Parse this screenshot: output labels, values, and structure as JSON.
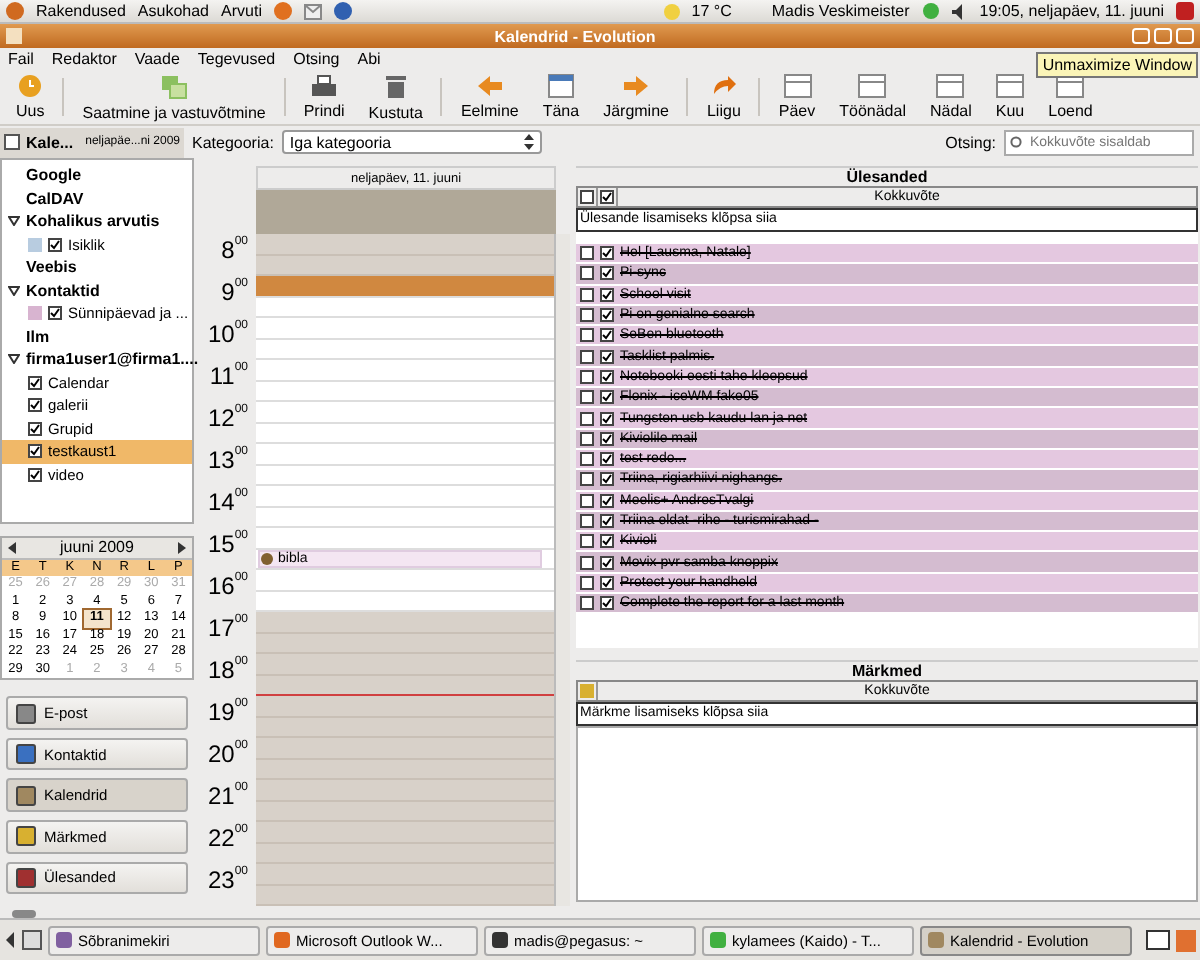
{
  "top_panel": {
    "menus": [
      "Rakendused",
      "Asukohad",
      "Arvuti"
    ],
    "weather": "17 °C",
    "user": "Madis Veskimeister",
    "clock": "19:05, neljapäev, 11. juuni"
  },
  "window": {
    "title": "Kalendrid - Evolution"
  },
  "menu": [
    "Fail",
    "Redaktor",
    "Vaade",
    "Tegevused",
    "Otsing",
    "Abi"
  ],
  "tooltip": "Unmaximize Window",
  "toolbar": [
    {
      "label": "Uus",
      "kind": "new"
    },
    {
      "label": "Saatmine ja vastuvõtmine",
      "kind": "sendrecv"
    },
    {
      "label": "Prindi",
      "kind": "print"
    },
    {
      "label": "Kustuta",
      "kind": "delete"
    },
    {
      "label": "Eelmine",
      "kind": "back"
    },
    {
      "label": "Täna",
      "kind": "today"
    },
    {
      "label": "Järgmine",
      "kind": "forward"
    },
    {
      "label": "Liigu",
      "kind": "goto"
    },
    {
      "label": "Päev",
      "kind": "view"
    },
    {
      "label": "Töönädal",
      "kind": "view"
    },
    {
      "label": "Nädal",
      "kind": "view"
    },
    {
      "label": "Kuu",
      "kind": "view"
    },
    {
      "label": "Loend",
      "kind": "view"
    }
  ],
  "sidebar": {
    "title": "Kale...",
    "date": "neljapäe...ni 2009",
    "groups": [
      {
        "name": "Google",
        "expanded": false
      },
      {
        "name": "CalDAV",
        "expanded": false
      },
      {
        "name": "Kohalikus arvutis",
        "expanded": true,
        "children": [
          {
            "name": "Isiklik",
            "checked": true,
            "color": "#b8cce0",
            "selected": false
          }
        ]
      },
      {
        "name": "Veebis",
        "expanded": false
      },
      {
        "name": "Kontaktid",
        "expanded": true,
        "children": [
          {
            "name": "Sünnipäevad ja ...",
            "checked": true,
            "color": "#d8b4d0",
            "selected": false
          }
        ]
      },
      {
        "name": "Ilm",
        "expanded": false
      },
      {
        "name": "firma1user1@firma1....",
        "expanded": true,
        "children": [
          {
            "name": "Calendar",
            "checked": true,
            "selected": false
          },
          {
            "name": "galerii",
            "checked": true,
            "selected": false
          },
          {
            "name": "Grupid",
            "checked": true,
            "selected": false
          },
          {
            "name": "testkaust1",
            "checked": true,
            "selected": true
          },
          {
            "name": "video",
            "checked": true,
            "selected": false
          }
        ]
      }
    ]
  },
  "mini_calendar": {
    "month": "juuni 2009",
    "weekdays": [
      "E",
      "T",
      "K",
      "N",
      "R",
      "L",
      "P"
    ],
    "days": [
      {
        "d": "25",
        "in_month": false,
        "selected": false
      },
      {
        "d": "26",
        "in_month": false,
        "selected": false
      },
      {
        "d": "27",
        "in_month": false,
        "selected": false
      },
      {
        "d": "28",
        "in_month": false,
        "selected": false
      },
      {
        "d": "29",
        "in_month": false,
        "selected": false
      },
      {
        "d": "30",
        "in_month": false,
        "selected": false
      },
      {
        "d": "31",
        "in_month": false,
        "selected": false
      },
      {
        "d": "1",
        "in_month": true,
        "selected": false
      },
      {
        "d": "2",
        "in_month": true,
        "selected": false
      },
      {
        "d": "3",
        "in_month": true,
        "selected": false
      },
      {
        "d": "4",
        "in_month": true,
        "selected": false
      },
      {
        "d": "5",
        "in_month": true,
        "selected": false
      },
      {
        "d": "6",
        "in_month": true,
        "selected": false
      },
      {
        "d": "7",
        "in_month": true,
        "selected": false
      },
      {
        "d": "8",
        "in_month": true,
        "selected": false
      },
      {
        "d": "9",
        "in_month": true,
        "selected": false
      },
      {
        "d": "10",
        "in_month": true,
        "selected": false
      },
      {
        "d": "11",
        "in_month": true,
        "selected": true
      },
      {
        "d": "12",
        "in_month": true,
        "selected": false
      },
      {
        "d": "13",
        "in_month": true,
        "selected": false
      },
      {
        "d": "14",
        "in_month": true,
        "selected": false
      },
      {
        "d": "15",
        "in_month": true,
        "selected": false
      },
      {
        "d": "16",
        "in_month": true,
        "selected": false
      },
      {
        "d": "17",
        "in_month": true,
        "selected": false
      },
      {
        "d": "18",
        "in_month": true,
        "selected": false
      },
      {
        "d": "19",
        "in_month": true,
        "selected": false
      },
      {
        "d": "20",
        "in_month": true,
        "selected": false
      },
      {
        "d": "21",
        "in_month": true,
        "selected": false
      },
      {
        "d": "22",
        "in_month": true,
        "selected": false
      },
      {
        "d": "23",
        "in_month": true,
        "selected": false
      },
      {
        "d": "24",
        "in_month": true,
        "selected": false
      },
      {
        "d": "25",
        "in_month": true,
        "selected": false
      },
      {
        "d": "26",
        "in_month": true,
        "selected": false
      },
      {
        "d": "27",
        "in_month": true,
        "selected": false
      },
      {
        "d": "28",
        "in_month": true,
        "selected": false
      },
      {
        "d": "29",
        "in_month": true,
        "selected": false
      },
      {
        "d": "30",
        "in_month": true,
        "selected": false
      },
      {
        "d": "1",
        "in_month": false,
        "selected": false
      },
      {
        "d": "2",
        "in_month": false,
        "selected": false
      },
      {
        "d": "3",
        "in_month": false,
        "selected": false
      },
      {
        "d": "4",
        "in_month": false,
        "selected": false
      },
      {
        "d": "5",
        "in_month": false,
        "selected": false
      }
    ]
  },
  "switcher": [
    {
      "label": "E-post",
      "kind": "mail",
      "selected": false
    },
    {
      "label": "Kontaktid",
      "kind": "contacts",
      "selected": false
    },
    {
      "label": "Kalendrid",
      "kind": "calendar",
      "selected": true
    },
    {
      "label": "Märkmed",
      "kind": "memos",
      "selected": false
    },
    {
      "label": "Ülesanded",
      "kind": "tasks",
      "selected": false
    }
  ],
  "filter": {
    "label": "Kategooria:",
    "value": "Iga kategooria",
    "search_label": "Otsing:",
    "search_placeholder": "Kokkuvõte sisaldab"
  },
  "day_view": {
    "date": "neljapäev, 11. juuni",
    "hours": [
      {
        "hour": "8",
        "minutes": "00",
        "work": false,
        "selected": false,
        "now": false
      },
      {
        "hour": "9",
        "minutes": "00",
        "work": true,
        "selected": true,
        "now": false
      },
      {
        "hour": "10",
        "minutes": "00",
        "work": true,
        "selected": false,
        "now": false
      },
      {
        "hour": "11",
        "minutes": "00",
        "work": true,
        "selected": false,
        "now": false
      },
      {
        "hour": "12",
        "minutes": "00",
        "work": true,
        "selected": false,
        "now": false
      },
      {
        "hour": "13",
        "minutes": "00",
        "work": true,
        "selected": false,
        "now": false
      },
      {
        "hour": "14",
        "minutes": "00",
        "work": true,
        "selected": false,
        "now": false
      },
      {
        "hour": "15",
        "minutes": "00",
        "work": true,
        "selected": false,
        "now": false,
        "event": "bibla"
      },
      {
        "hour": "16",
        "minutes": "00",
        "work": true,
        "selected": false,
        "now": false
      },
      {
        "hour": "17",
        "minutes": "00",
        "work": false,
        "selected": false,
        "now": false
      },
      {
        "hour": "18",
        "minutes": "00",
        "work": false,
        "selected": false,
        "now": true
      },
      {
        "hour": "19",
        "minutes": "00",
        "work": false,
        "selected": false,
        "now": false
      },
      {
        "hour": "20",
        "minutes": "00",
        "work": false,
        "selected": false,
        "now": false
      },
      {
        "hour": "21",
        "minutes": "00",
        "work": false,
        "selected": false,
        "now": false
      },
      {
        "hour": "22",
        "minutes": "00",
        "work": false,
        "selected": false,
        "now": false
      },
      {
        "hour": "23",
        "minutes": "00",
        "work": false,
        "selected": false,
        "now": false
      }
    ]
  },
  "tasks": {
    "title": "Ülesanded",
    "column": "Kokkuvõte",
    "add_hint": "Ülesande lisamiseks klõpsa siia",
    "rows": [
      {
        "summary": "Hel [Lausma, Natale]",
        "marked": false,
        "done": true
      },
      {
        "summary": "Pi-sync",
        "marked": false,
        "done": true
      },
      {
        "summary": "School visit",
        "marked": false,
        "done": true
      },
      {
        "summary": "Pi on genialne search",
        "marked": false,
        "done": true
      },
      {
        "summary": "SeBen bluetooth",
        "marked": false,
        "done": true
      },
      {
        "summary": "Tasklist palmis.",
        "marked": false,
        "done": true
      },
      {
        "summary": "Notebooki eesti tahe kleepsud",
        "marked": false,
        "done": true
      },
      {
        "summary": "Flonix - iceWM fake05",
        "marked": false,
        "done": true
      },
      {
        "summary": "Tungsten usb kaudu lan ja net",
        "marked": false,
        "done": true
      },
      {
        "summary": "Kiviolile mail",
        "marked": false,
        "done": true
      },
      {
        "summary": "test redo...",
        "marked": false,
        "done": true
      },
      {
        "summary": "Triina, rigiarhiivi nighangs.",
        "marked": false,
        "done": true
      },
      {
        "summary": "Meelis+ AndresTvalgi",
        "marked": false,
        "done": true
      },
      {
        "summary": "Triina eldat -rihe - turismirahad -",
        "marked": false,
        "done": true
      },
      {
        "summary": "Kivioli",
        "marked": false,
        "done": true
      },
      {
        "summary": "Movix pvr samba knoppix",
        "marked": false,
        "done": true
      },
      {
        "summary": "Protect your handheld",
        "marked": false,
        "done": true
      },
      {
        "summary": "Complete the report for a last month",
        "marked": false,
        "done": true
      }
    ]
  },
  "memos": {
    "title": "Märkmed",
    "column": "Kokkuvõte",
    "add_hint": "Märkme lisamiseks klõpsa siia"
  },
  "taskbar": [
    {
      "label": "Sõbranimekiri",
      "kind": "chat",
      "selected": false
    },
    {
      "label": "Microsoft Outlook W...",
      "kind": "browser",
      "selected": false
    },
    {
      "label": "madis@pegasus: ~",
      "kind": "terminal",
      "selected": false
    },
    {
      "label": "kylamees (Kaido) - T...",
      "kind": "presence",
      "selected": false
    },
    {
      "label": "Kalendrid - Evolution",
      "kind": "calendar",
      "selected": true
    }
  ]
}
